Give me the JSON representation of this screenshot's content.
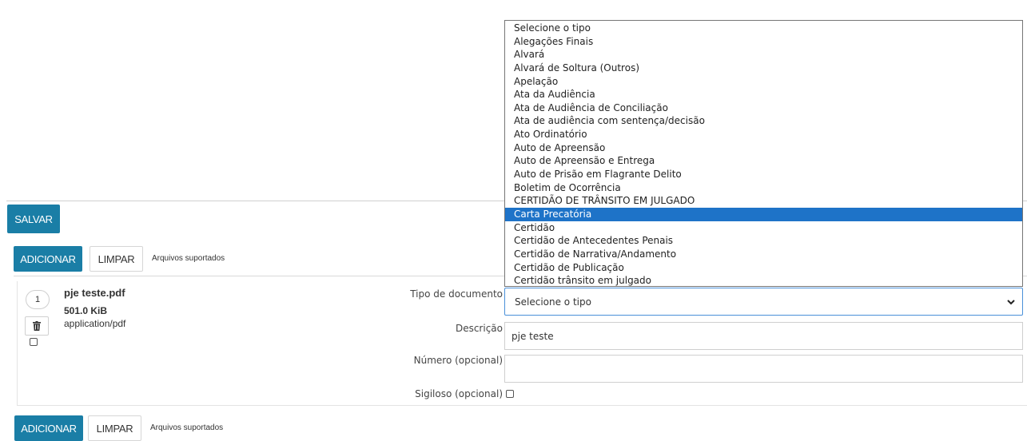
{
  "toolbar": {
    "save_label": "SALVAR"
  },
  "upload_bar_top": {
    "add_label": "ADICIONAR",
    "clear_label": "LIMPAR",
    "supported_label": "Arquivos suportados"
  },
  "upload_bar_bottom": {
    "add_label": "ADICIONAR",
    "clear_label": "LIMPAR",
    "supported_label": "Arquivos suportados"
  },
  "file": {
    "index": "1",
    "name": "pje teste.pdf",
    "size": "501.0 KiB",
    "mime": "application/pdf"
  },
  "form": {
    "doc_type_label": "Tipo de documento",
    "doc_type_value": "Selecione o tipo",
    "description_label": "Descrição",
    "description_value": "pje teste",
    "number_label": "Número (opcional)",
    "number_value": "",
    "secret_label": "Sigiloso (opcional)"
  },
  "dropdown": {
    "selected_index": 14,
    "options": [
      "Selecione o tipo",
      "Alegações Finais",
      "Alvará",
      "Alvará de Soltura (Outros)",
      "Apelação",
      "Ata da Audiência",
      "Ata de Audiência de Conciliação",
      "Ata de audiência com sentença/decisão",
      "Ato Ordinatório",
      "Auto de Apreensão",
      "Auto de Apreensão e Entrega",
      "Auto de Prisão em Flagrante Delito",
      "Boletim de Ocorrência",
      "CERTIDÃO DE TRÂNSITO EM JULGADO",
      "Carta Precatória",
      "Certidão",
      "Certidão de Antecedentes Penais",
      "Certidão de Narrativa/Andamento",
      "Certidão de Publicação",
      "Certidão trânsito em julgado"
    ]
  },
  "colors": {
    "primary": "#1a7ea6",
    "highlight": "#1e73c8"
  }
}
